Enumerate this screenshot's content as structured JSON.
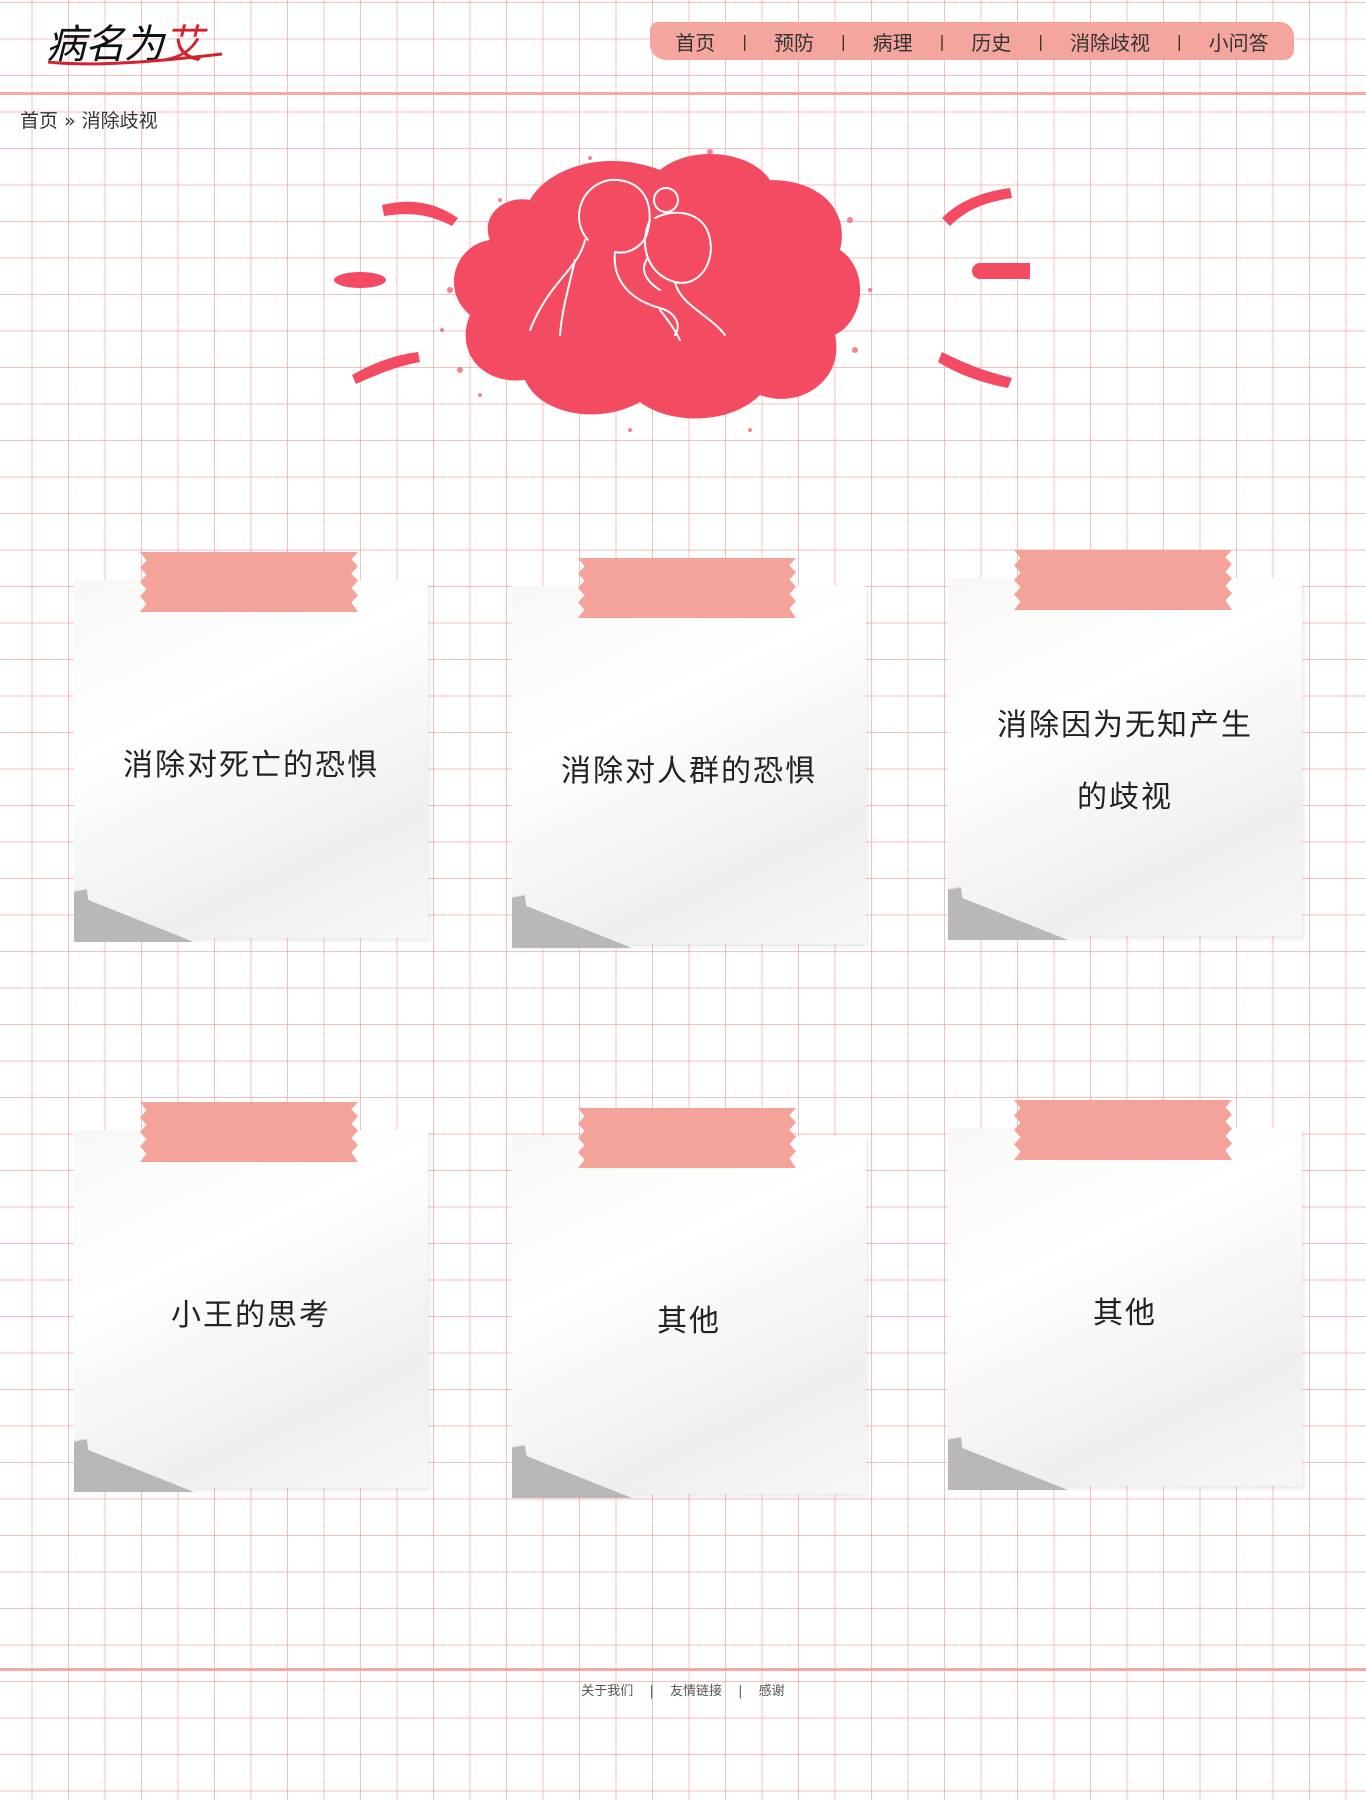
{
  "logo": {
    "text_main": "病名为",
    "text_accent": "艾"
  },
  "nav": {
    "items": [
      "首页",
      "预防",
      "病理",
      "历史",
      "消除歧视",
      "小问答"
    ],
    "separator": "|"
  },
  "breadcrumb": {
    "home": "首页",
    "arrow": "»",
    "current": "消除歧视"
  },
  "notes": [
    {
      "line1": "消除对死亡的恐惧",
      "line2": ""
    },
    {
      "line1": "消除对人群的恐惧",
      "line2": ""
    },
    {
      "line1": "消除因为无知产生",
      "line2": "的歧视"
    },
    {
      "line1": "小王的思考",
      "line2": ""
    },
    {
      "line1": "其他",
      "line2": ""
    },
    {
      "line1": "其他",
      "line2": ""
    }
  ],
  "footer": {
    "about": "关于我们",
    "links": "友情链接",
    "thanks": "感谢",
    "separator": "|"
  },
  "colors": {
    "accent": "#f4a59d",
    "hero_red": "#f24b62",
    "grid": "#f08c8c"
  }
}
